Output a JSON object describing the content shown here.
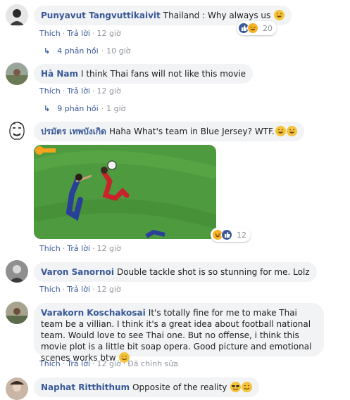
{
  "common": {
    "like_label": "Thích",
    "reply_label": "Trả lời",
    "edited_label": "Đã chỉnh sửa",
    "reply_arrow": "↳"
  },
  "comments": [
    {
      "author": "Punyavut Tangvuttikaivit",
      "text": "Thailand : Why always us",
      "time": "12 giờ",
      "reactions": "20",
      "replies": "4 phản hồi",
      "replies_time": "10 giờ"
    },
    {
      "author": "Hà Nam",
      "text": "I think Thai fans will not like this movie",
      "time": "12 giờ",
      "replies": "9 phản hồi",
      "replies_time": "1 giờ"
    },
    {
      "author": "ปรมัตร เทพบังเกิด",
      "text": "Haha What's team in Blue Jersey? WTF.",
      "time": "12 giờ",
      "reactions": "12"
    },
    {
      "author": "Varon Sanornoi",
      "text": "Double tackle shot is so stunning for me. Lolz",
      "time": "12 giờ"
    },
    {
      "author": "Varakorn Koschakosai",
      "text": "It's totally fine for me to make Thai team be a villian. I think it's a great idea about football national team. Would love to see Thai one. But no offense, i think this movie plot is a little bit soap opera. Good picture and emotional scenes works btw",
      "time": "12 giờ"
    },
    {
      "author": "Naphat Ritthithum",
      "text": "Opposite of the reality"
    }
  ],
  "colors": {
    "link": "#385898",
    "bubble": "#f2f3f5",
    "meta": "#90949c",
    "like": "#3b5998",
    "haha": "#f7b125",
    "pitch": "#4e9a3e"
  },
  "icons": [
    "like-reaction-icon",
    "haha-reaction-icon",
    "laughing-emoji-icon",
    "smiling-emoji-icon",
    "sunglasses-emoji-icon",
    "reply-arrow-icon"
  ]
}
